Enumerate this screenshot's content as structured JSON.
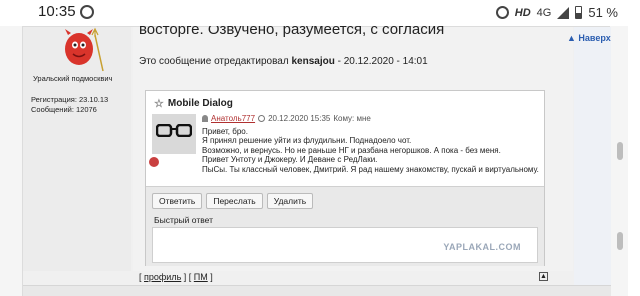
{
  "status_bar": {
    "time": "10:35",
    "network": "HD",
    "signal": "4G",
    "battery": "51 %"
  },
  "post": {
    "top_text": "восторге. Озвучено, разумеется, с согласия",
    "edit_prefix": "Это сообщение отредактировал",
    "edit_user": "kensajou",
    "edit_date": "- 20.12.2020 - 14:01"
  },
  "author": {
    "name": "Уральский подмосквич",
    "registration": "Регистрация: 23.10.13",
    "messages": "Сообщений: 12076"
  },
  "dialog": {
    "title": "Mobile Dialog",
    "sender": "Анатоль777",
    "date": "20.12.2020 15:35",
    "to": "Кому: мне",
    "lines": [
      "Привет, бро.",
      "Я принял решение уйти из флудильни. Поднадоело чот.",
      "Возможно, и вернусь. Но не раньше НГ и разбана негоршков. А пока - без меня.",
      "Привет Унтоту и Джокеру. И Деване с РедЛаки.",
      "ПыСы. Ты классный человек, Дмитрий. Я рад нашему знакомству, пускай и виртуальному."
    ],
    "buttons": {
      "reply": "Ответить",
      "forward": "Переслать",
      "delete": "Удалить"
    },
    "quick_reply_label": "Быстрый ответ",
    "watermark": "YAPLAKAL.COM"
  },
  "footer_links": {
    "profile": "профиль",
    "pm": "ПМ"
  },
  "nav": {
    "up_label": "Наверх"
  }
}
